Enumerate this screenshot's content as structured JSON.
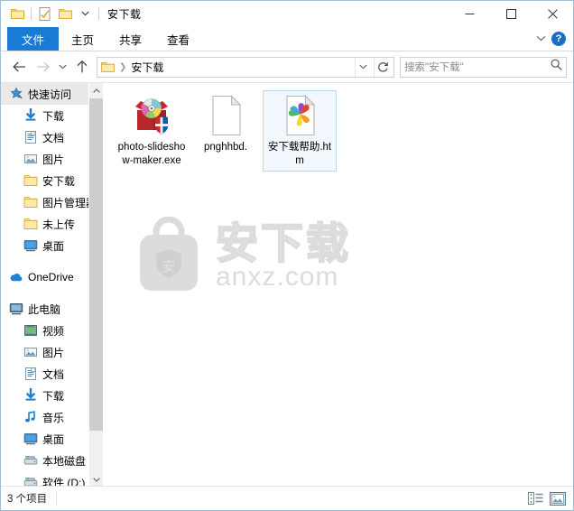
{
  "window": {
    "title": "安下载",
    "quick_access_toolbar": [
      {
        "name": "folder-properties",
        "icon": "folder-icon"
      },
      {
        "name": "properties-checkbox",
        "icon": "checklist-icon"
      },
      {
        "name": "new-folder",
        "icon": "folder-icon"
      },
      {
        "name": "customize-dropdown",
        "icon": "chevron-down-icon"
      }
    ],
    "controls": {
      "minimize": "—",
      "maximize": "□",
      "close": "✕"
    }
  },
  "ribbon": {
    "tabs": [
      {
        "label": "文件",
        "active": true
      },
      {
        "label": "主页",
        "active": false
      },
      {
        "label": "共享",
        "active": false
      },
      {
        "label": "查看",
        "active": false
      }
    ],
    "collapse_icon": "chevron-down-icon",
    "help_label": "?"
  },
  "address": {
    "back_icon": "arrow-left-icon",
    "forward_icon": "arrow-right-icon",
    "recent_icon": "chevron-down-icon",
    "up_icon": "arrow-up-icon",
    "breadcrumb": [
      {
        "icon": "folder-icon",
        "label": ""
      },
      {
        "label": "安下载"
      }
    ],
    "path_text": "安下载",
    "dropdown_icon": "chevron-down-icon",
    "refresh_icon": "refresh-icon"
  },
  "search": {
    "placeholder": "搜索\"安下载\"",
    "icon": "search-icon"
  },
  "sidebar": {
    "scrollbar": {
      "up_icon": "chevron-up-icon",
      "down_icon": "chevron-down-icon"
    },
    "items": [
      {
        "label": "快速访问",
        "icon": "star-pin-icon",
        "indent": 0,
        "selected": true,
        "pinned": false
      },
      {
        "label": "下载",
        "icon": "download-icon",
        "indent": 1,
        "selected": false,
        "pinned": true
      },
      {
        "label": "文档",
        "icon": "document-icon",
        "indent": 1,
        "selected": false,
        "pinned": true
      },
      {
        "label": "图片",
        "icon": "pictures-icon",
        "indent": 1,
        "selected": false,
        "pinned": true
      },
      {
        "label": "安下载",
        "icon": "folder-icon",
        "indent": 1,
        "selected": false,
        "pinned": false
      },
      {
        "label": "图片管理器",
        "icon": "folder-icon",
        "indent": 1,
        "selected": false,
        "pinned": false
      },
      {
        "label": "未上传",
        "icon": "folder-icon",
        "indent": 1,
        "selected": false,
        "pinned": false
      },
      {
        "label": "桌面",
        "icon": "desktop-icon",
        "indent": 1,
        "selected": false,
        "pinned": false
      },
      {
        "label": "OneDrive",
        "icon": "onedrive-icon",
        "indent": 0,
        "selected": false,
        "pinned": false,
        "spacer_before": true
      },
      {
        "label": "此电脑",
        "icon": "this-pc-icon",
        "indent": 0,
        "selected": false,
        "pinned": false,
        "spacer_before": true
      },
      {
        "label": "视频",
        "icon": "videos-icon",
        "indent": 1,
        "selected": false,
        "pinned": false
      },
      {
        "label": "图片",
        "icon": "pictures-icon",
        "indent": 1,
        "selected": false,
        "pinned": false
      },
      {
        "label": "文档",
        "icon": "document-icon",
        "indent": 1,
        "selected": false,
        "pinned": false
      },
      {
        "label": "下载",
        "icon": "download-icon",
        "indent": 1,
        "selected": false,
        "pinned": false
      },
      {
        "label": "音乐",
        "icon": "music-icon",
        "indent": 1,
        "selected": false,
        "pinned": false
      },
      {
        "label": "桌面",
        "icon": "desktop-icon",
        "indent": 1,
        "selected": false,
        "pinned": false
      },
      {
        "label": "本地磁盘 (C:)",
        "icon": "drive-icon",
        "indent": 1,
        "selected": false,
        "pinned": false
      },
      {
        "label": "软件 (D:)",
        "icon": "drive-icon",
        "indent": 1,
        "selected": false,
        "pinned": false
      }
    ]
  },
  "content": {
    "files": [
      {
        "name": "photo-slideshow-maker.exe",
        "icon": "installer-package-icon",
        "selected": false
      },
      {
        "name": "pnghhbd.",
        "icon": "blank-document-icon",
        "selected": false
      },
      {
        "name": "安下载帮助.htm",
        "icon": "html-pinwheel-icon",
        "selected": true
      }
    ],
    "watermark": {
      "badge_char": "安",
      "brand_cn": "安下载",
      "brand_url": "anxz.com",
      "color": "#dcdcdc"
    }
  },
  "status": {
    "item_count_text": "3 个项目",
    "views": [
      {
        "name": "details-view-button",
        "icon": "details-view-icon",
        "active": false
      },
      {
        "name": "large-icons-view-button",
        "icon": "large-icons-view-icon",
        "active": true
      }
    ]
  },
  "colors": {
    "accent_blue": "#1a7bd4",
    "window_border": "#9dbfd9",
    "selection_fill": "#f2f8fd",
    "selection_border": "#bdd8ef",
    "nav_selected": "#e9e9e9"
  }
}
